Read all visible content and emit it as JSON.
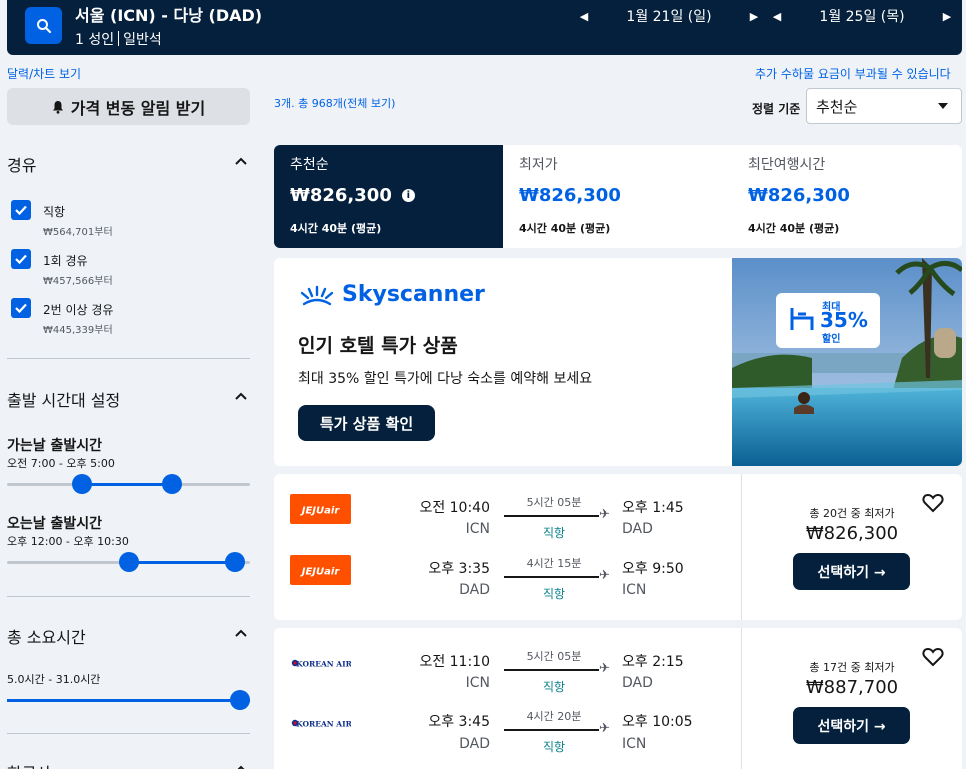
{
  "header": {
    "route": "서울 (ICN) - 다낭 (DAD)",
    "passengers": "1 성인",
    "cabin": "일반석",
    "depart_date": "1월 21일 (일)",
    "return_date": "1월 25일 (목)"
  },
  "links": {
    "calendar": "달력/차트 보기",
    "extra_fees": "추가 수하물 요금이 부과될 수 있습니다"
  },
  "sidebar": {
    "price_alert": "가격 변동 알림 받기",
    "stops": {
      "title": "경유",
      "options": [
        {
          "label": "직항",
          "price": "₩564,701부터",
          "checked": true
        },
        {
          "label": "1회 경유",
          "price": "₩457,566부터",
          "checked": true
        },
        {
          "label": "2번 이상 경유",
          "price": "₩445,339부터",
          "checked": true
        }
      ]
    },
    "times": {
      "title": "출발 시간대 설정",
      "outbound_label": "가는날 출발시간",
      "outbound_range": "오전 7:00 - 오후 5:00",
      "outbound_slider": [
        0.31,
        0.68
      ],
      "return_label": "오는날 출발시간",
      "return_range": "오후 12:00 - 오후 10:30",
      "return_slider": [
        0.5,
        0.94
      ]
    },
    "duration": {
      "title": "총 소요시간",
      "range": "5.0시간 - 31.0시간",
      "slider": [
        0.0,
        1.0
      ]
    },
    "airlines_title": "항공사"
  },
  "results": {
    "count": "3개. 총 968개(전체 보기)",
    "sort_label": "정렬 기준",
    "sort_value": "추천순"
  },
  "tabs": [
    {
      "name": "추천순",
      "price": "₩826,300",
      "duration": "4시간 40분 (평균)",
      "active": true
    },
    {
      "name": "최저가",
      "price": "₩826,300",
      "duration": "4시간 40분 (평균)",
      "active": false
    },
    {
      "name": "최단여행시간",
      "price": "₩826,300",
      "duration": "4시간 40분 (평균)",
      "active": false
    }
  ],
  "ad": {
    "brand": "Skyscanner",
    "title": "인기 호텔 특가 상품",
    "subtitle": "최대 35% 할인 특가에 다낭 숙소를 예약해 보세요",
    "button": "특가 상품 확인",
    "badge_top": "최대",
    "badge_pct": "35%",
    "badge_bottom": "할인"
  },
  "flights": [
    {
      "airline": "JEJUair",
      "legs": [
        {
          "dep_time": "오전 10:40",
          "dep_code": "ICN",
          "duration": "5시간 05분",
          "stops": "직항",
          "arr_time": "오후 1:45",
          "arr_code": "DAD"
        },
        {
          "dep_time": "오후 3:35",
          "dep_code": "DAD",
          "duration": "4시간 15분",
          "stops": "직항",
          "arr_time": "오후 9:50",
          "arr_code": "ICN"
        }
      ],
      "deals": "총 20건 중 최저가",
      "price": "₩826,300",
      "select": "선택하기 →"
    },
    {
      "airline": "KOREAN AIR",
      "legs": [
        {
          "dep_time": "오전 11:10",
          "dep_code": "ICN",
          "duration": "5시간 05분",
          "stops": "직항",
          "arr_time": "오후 2:15",
          "arr_code": "DAD"
        },
        {
          "dep_time": "오후 3:45",
          "dep_code": "DAD",
          "duration": "4시간 20분",
          "stops": "직항",
          "arr_time": "오후 10:05",
          "arr_code": "ICN"
        }
      ],
      "deals": "총 17건 중 최저가",
      "price": "₩887,700",
      "select": "선택하기 →"
    }
  ],
  "colors": {
    "navy": "#05203c",
    "accent": "#0062e3",
    "direct": "#0c838a",
    "jeju": "#ff5000",
    "korean_air": "#0d2f8a"
  }
}
